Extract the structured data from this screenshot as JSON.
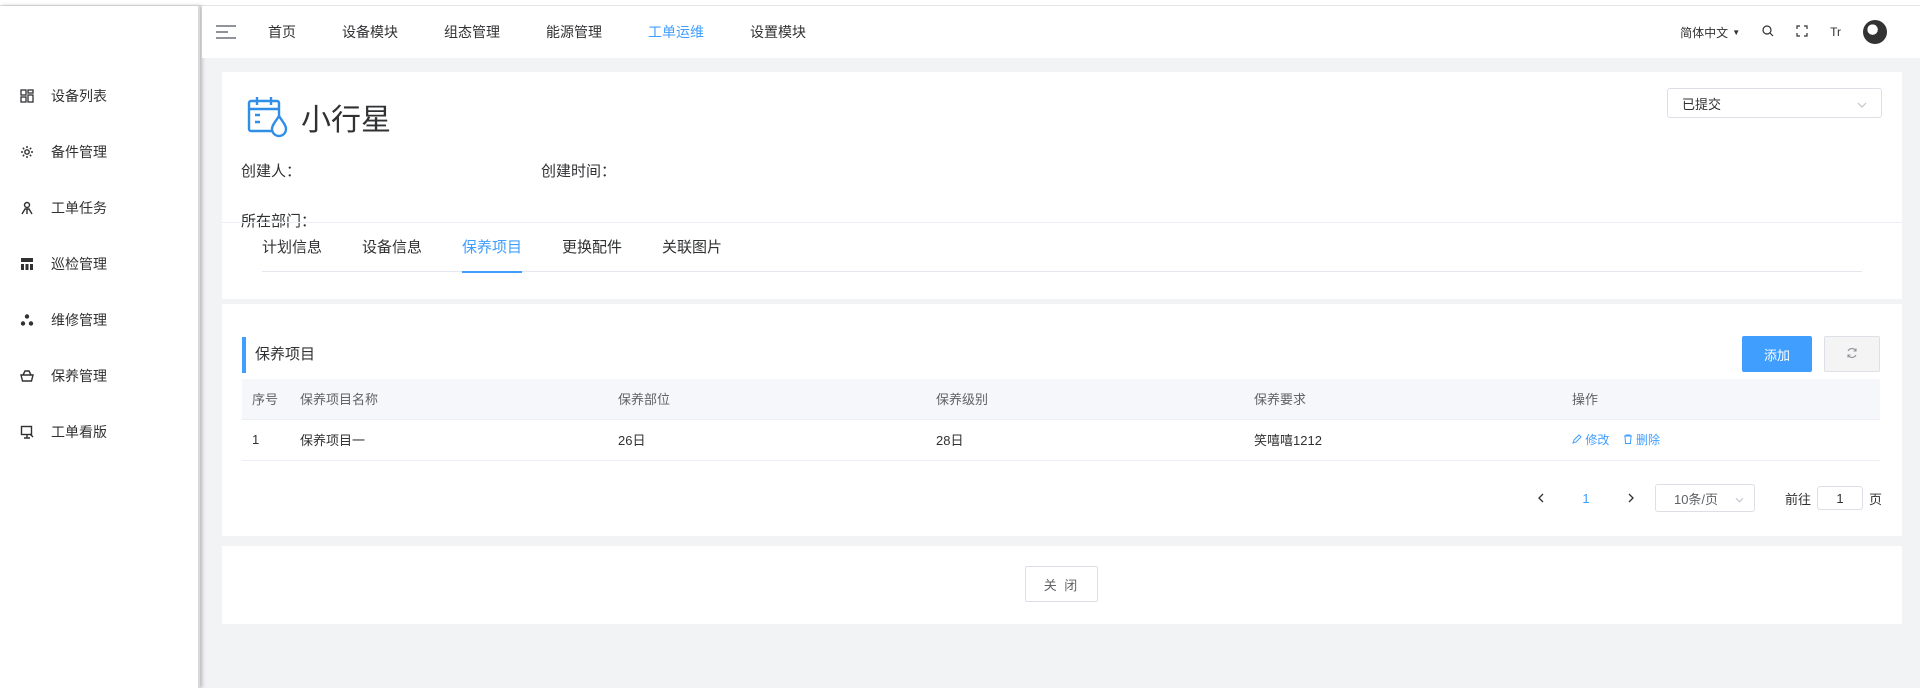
{
  "sidebar": {
    "items": [
      {
        "label": "设备列表",
        "icon": "grid-icon"
      },
      {
        "label": "备件管理",
        "icon": "gear-icon"
      },
      {
        "label": "工单任务",
        "icon": "worker-icon"
      },
      {
        "label": "巡检管理",
        "icon": "hierarchy-icon"
      },
      {
        "label": "维修管理",
        "icon": "nodes-icon"
      },
      {
        "label": "保养管理",
        "icon": "basket-icon"
      },
      {
        "label": "工单看版",
        "icon": "monitor-icon"
      }
    ]
  },
  "topnav": {
    "items": [
      {
        "label": "首页",
        "active": false
      },
      {
        "label": "设备模块",
        "active": false
      },
      {
        "label": "组态管理",
        "active": false
      },
      {
        "label": "能源管理",
        "active": false
      },
      {
        "label": "工单运维",
        "active": true
      },
      {
        "label": "设置模块",
        "active": false
      }
    ],
    "language": "简体中文",
    "font_size_glyph": "Tr"
  },
  "header": {
    "title": "小行星",
    "status": "已提交",
    "creator_label": "创建人：",
    "created_time_label": "创建时间：",
    "department_label": "所在部门："
  },
  "tabs": [
    {
      "label": "计划信息",
      "active": false
    },
    {
      "label": "设备信息",
      "active": false
    },
    {
      "label": "保养项目",
      "active": true
    },
    {
      "label": "更换配件",
      "active": false
    },
    {
      "label": "关联图片",
      "active": false
    }
  ],
  "section": {
    "title": "保养项目",
    "add_label": "添加"
  },
  "table": {
    "columns": [
      "序号",
      "保养项目名称",
      "保养部位",
      "保养级别",
      "保养要求",
      "操作"
    ],
    "rows": [
      {
        "index": "1",
        "name": "保养项目一",
        "part": "26日",
        "level": "28日",
        "requirement": "笑嘻嘻1212",
        "edit": "修改",
        "delete": "删除"
      }
    ]
  },
  "pagination": {
    "current_page": "1",
    "page_size": "10条/页",
    "goto_label": "前往",
    "goto_value": "1",
    "page_suffix": "页"
  },
  "footer": {
    "close_label": "关 闭"
  },
  "colors": {
    "accent": "#409eff",
    "text": "#303133",
    "background": "#f2f3f5"
  }
}
